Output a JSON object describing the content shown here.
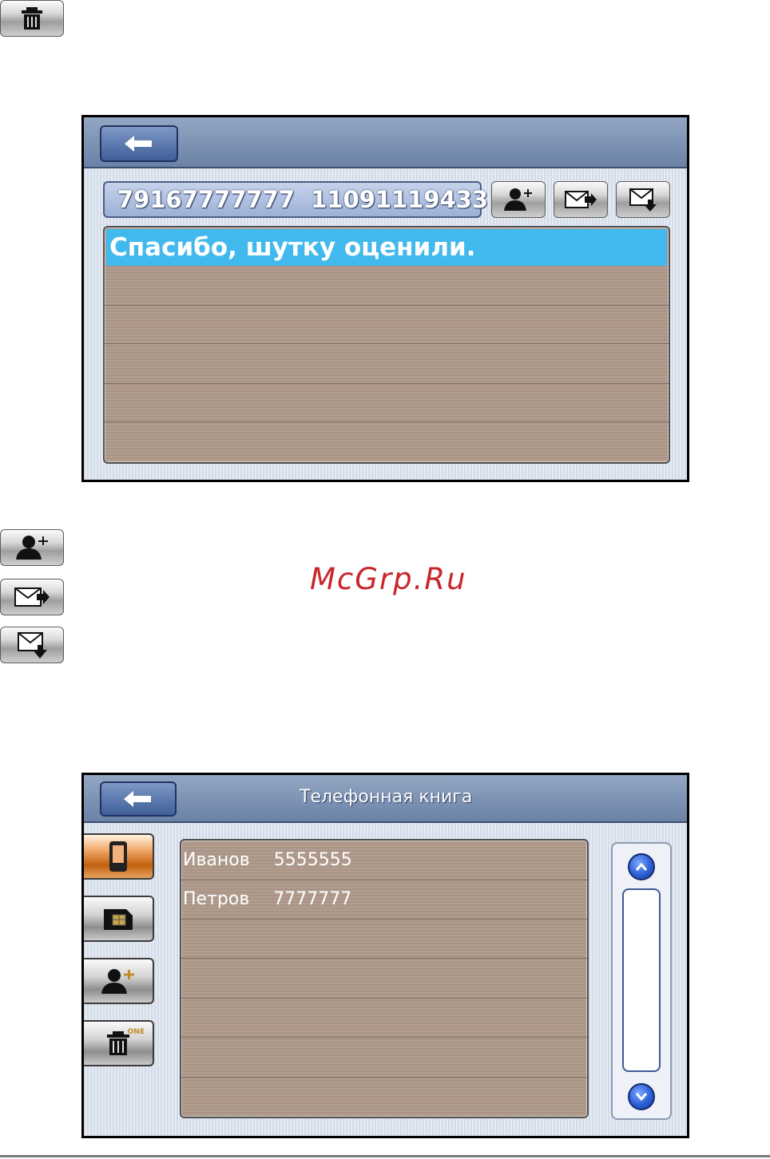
{
  "message_screen": {
    "sender_numbers": "79167777777  11091119433",
    "messages": [
      "Спасибо, шутку оценили.",
      "",
      "",
      "",
      "",
      ""
    ]
  },
  "watermark": "McGrp.Ru",
  "phonebook_screen": {
    "title": "Телефонная книга",
    "contacts": [
      {
        "name": "Иванов",
        "number": "5555555"
      },
      {
        "name": "Петров",
        "number": "7777777"
      },
      {
        "name": "",
        "number": ""
      },
      {
        "name": "",
        "number": ""
      },
      {
        "name": "",
        "number": ""
      },
      {
        "name": "",
        "number": ""
      },
      {
        "name": "",
        "number": ""
      }
    ],
    "delete_badge": "ONE"
  },
  "colors": {
    "topbar": "#6b82a6",
    "selection": "#42b9ec",
    "panel": "#ad998b",
    "watermark": "#c9252b",
    "active_tab": "#c0620f"
  }
}
